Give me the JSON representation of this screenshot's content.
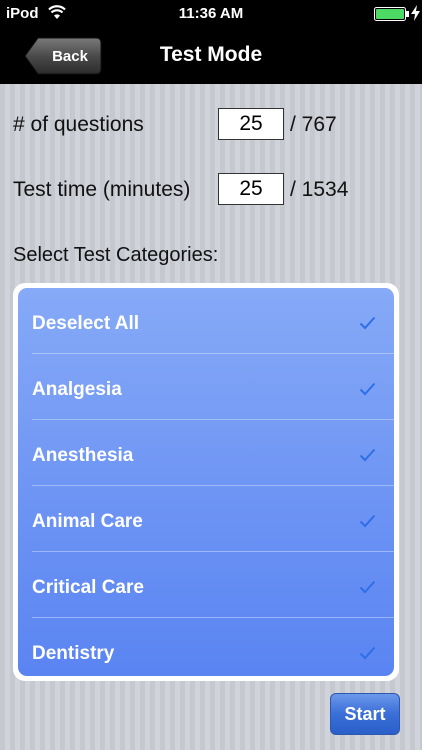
{
  "status_bar": {
    "carrier": "iPod",
    "time": "11:36 AM"
  },
  "nav": {
    "back_label": "Back",
    "title": "Test Mode"
  },
  "questions": {
    "label": "# of questions",
    "value": "25",
    "total": "/ 767"
  },
  "test_time": {
    "label": "Test time (minutes)",
    "value": "25",
    "total": "/ 1534"
  },
  "categories": {
    "title": "Select Test Categories:",
    "items": [
      {
        "label": "Deselect All",
        "checked": true
      },
      {
        "label": "Analgesia",
        "checked": true
      },
      {
        "label": "Anesthesia",
        "checked": true
      },
      {
        "label": "Animal Care",
        "checked": true
      },
      {
        "label": "Critical Care",
        "checked": true
      },
      {
        "label": "Dentistry",
        "checked": true
      }
    ]
  },
  "start_label": "Start",
  "colors": {
    "accent": "#3a6fd8",
    "list_blue": "#6f96f4",
    "check": "#2f6fe6"
  },
  "icons": [
    "wifi-icon",
    "battery-icon",
    "charging-icon",
    "check-icon"
  ]
}
